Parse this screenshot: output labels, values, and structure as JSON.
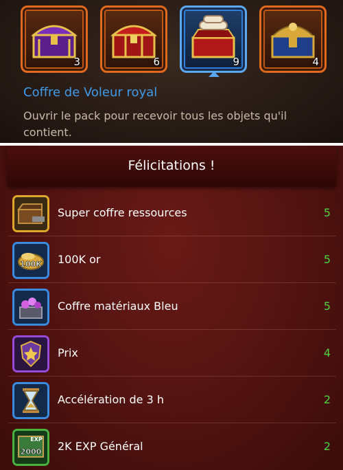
{
  "top_panel": {
    "chests": [
      {
        "name": "purple-chest",
        "count": "3",
        "selected": false
      },
      {
        "name": "red-chest",
        "count": "6",
        "selected": false
      },
      {
        "name": "scroll-chest",
        "count": "9",
        "selected": true
      },
      {
        "name": "gold-blue-chest",
        "count": "4",
        "selected": false
      }
    ],
    "selected_title": "Coffre de Voleur royal",
    "selected_description": "Ouvrir le pack pour recevoir tous les objets qu'il contient.",
    "title_color": "#3f9ae8"
  },
  "rewards_dialog": {
    "title": "Félicitations !",
    "items": [
      {
        "label": "Super coffre ressources",
        "qty": "5",
        "icon": "resource-chest-icon",
        "frame": "gold"
      },
      {
        "label": "100K or",
        "qty": "5",
        "icon": "gold-coins-icon",
        "badge": "100K",
        "frame": "blue"
      },
      {
        "label": "Coffre matériaux Bleu",
        "qty": "5",
        "icon": "materials-chest-icon",
        "frame": "blue"
      },
      {
        "label": "Prix",
        "qty": "4",
        "icon": "medal-shield-icon",
        "frame": "purple"
      },
      {
        "label": "Accélération de 3 h",
        "qty": "2",
        "icon": "hourglass-icon",
        "frame": "blue"
      },
      {
        "label": "2K EXP Général",
        "qty": "2",
        "icon": "exp-book-icon",
        "badge": "2000",
        "badge_top": "EXP",
        "frame": "green"
      }
    ],
    "qty_color": "#4cd43c"
  }
}
